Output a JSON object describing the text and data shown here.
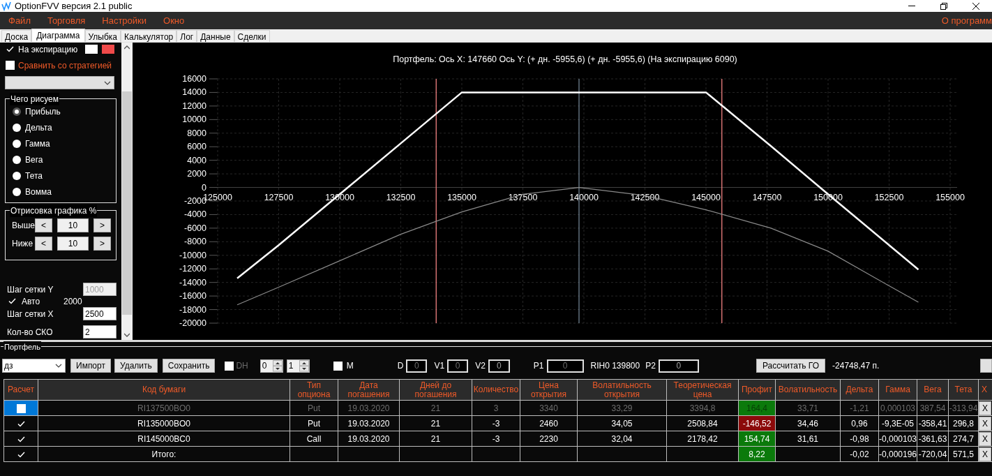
{
  "window": {
    "title": "OptionFVV версия 2.1 public"
  },
  "menu": [
    {
      "label": "Файл"
    },
    {
      "label": "Торговля"
    },
    {
      "label": "Настройки"
    },
    {
      "label": "Окно"
    }
  ],
  "menu_right": {
    "label": "О программ"
  },
  "tabs": [
    {
      "label": "Доска",
      "selected": false
    },
    {
      "label": "Диаграмма",
      "selected": true
    },
    {
      "label": "Улыбка",
      "selected": false
    },
    {
      "label": "Калькулятор",
      "selected": false
    },
    {
      "label": "Лог",
      "selected": false
    },
    {
      "label": "Данные",
      "selected": false
    },
    {
      "label": "Сделки",
      "selected": false
    }
  ],
  "left_panel": {
    "expiration": {
      "label": "На экспирацию",
      "checked": true,
      "swatches": [
        {
          "color": "#ffffff"
        },
        {
          "color": "#f04a4a"
        }
      ]
    },
    "compare": {
      "label": "Сравнить со стратегией",
      "checked": false
    },
    "draw_group": {
      "title": "Чего рисуем",
      "options": [
        {
          "label": "Прибыль",
          "selected": true
        },
        {
          "label": "Дельта",
          "selected": false
        },
        {
          "label": "Гамма",
          "selected": false
        },
        {
          "label": "Вега",
          "selected": false
        },
        {
          "label": "Тета",
          "selected": false
        },
        {
          "label": "Вомма",
          "selected": false
        }
      ]
    },
    "range_group": {
      "title": "Отрисовка графика %",
      "rows": [
        {
          "label": "Выше",
          "dec": "<",
          "value": "10",
          "inc": ">"
        },
        {
          "label": "Ниже",
          "dec": "<",
          "value": "10",
          "inc": ">"
        }
      ]
    },
    "grid_y": {
      "label": "Шаг сетки Y",
      "value": "1000",
      "disabled": true
    },
    "auto": {
      "label": "Авто",
      "checked": true,
      "value": "2000"
    },
    "grid_x": {
      "label": "Шаг сетки X",
      "value": "2500"
    },
    "sko": {
      "label": "Кол-во СКО",
      "value": "2"
    }
  },
  "chart": {
    "chart_data": {
      "type": "line",
      "title": "Портфель: Ось X:  147660 Ось Y:  (+ дн. -5955,6)  (+ дн. -5955,6)  (На экспирацию 6090)",
      "x": [
        125800,
        127500,
        130000,
        132500,
        135000,
        137500,
        139800,
        142500,
        145000,
        147660,
        150000,
        152500,
        153700
      ],
      "xlim": [
        125000,
        155000
      ],
      "ylim": [
        -20000,
        16000
      ],
      "xticks": [
        125000,
        127500,
        130000,
        132500,
        135000,
        137500,
        140000,
        142500,
        145000,
        147500,
        150000,
        152500,
        155000
      ],
      "yticks": [
        -20000,
        -18000,
        -16000,
        -14000,
        -12000,
        -10000,
        -8000,
        -6000,
        -4000,
        -2000,
        0,
        2000,
        4000,
        6000,
        8000,
        10000,
        12000,
        14000,
        16000
      ],
      "series": [
        {
          "color": "#ffffff",
          "values": [
            -13400,
            -8500,
            -1000,
            6500,
            14000,
            14000,
            14000,
            14000,
            14000,
            6100,
            -1000,
            -8500,
            -12100
          ]
        },
        {
          "color": "#8a8a8a",
          "values": [
            -17300,
            -14700,
            -10800,
            -6900,
            -3600,
            -1000,
            0,
            -1200,
            -3300,
            -6000,
            -9400,
            -14500,
            -16900
          ]
        }
      ],
      "grid": true,
      "ref_lines": [
        {
          "axis": "x",
          "value": 133950,
          "color": "#f08080"
        },
        {
          "axis": "x",
          "value": 139800,
          "color": "#6f8090"
        },
        {
          "axis": "x",
          "value": 145650,
          "color": "#f08080"
        }
      ]
    }
  },
  "portfolio": {
    "title": "Портфель",
    "strategy": "дз",
    "buttons": [
      {
        "label": "Импорт"
      },
      {
        "label": "Удалить"
      },
      {
        "label": "Сохранить"
      }
    ],
    "dh": {
      "label": "DH",
      "checked": false,
      "disabled": true
    },
    "spinners": [
      {
        "value": "0"
      },
      {
        "value": "1"
      }
    ],
    "m": {
      "label": "M",
      "checked": false
    },
    "fields": [
      {
        "kind": "field",
        "label": "D",
        "value": "0",
        "disabled": true
      },
      {
        "kind": "field",
        "label": "V1",
        "value": "0",
        "disabled": true
      },
      {
        "kind": "field",
        "label": "V2",
        "value": "0",
        "disabled": false
      },
      {
        "kind": "field",
        "label": "P1",
        "value": "0",
        "disabled": true
      },
      {
        "kind": "text",
        "text": "RIH0 139800"
      },
      {
        "kind": "field",
        "label": "P2",
        "value": "0",
        "disabled": false
      }
    ],
    "calc_button": {
      "label": "Рассчитать ГО"
    },
    "margin": "-24748,47 п.",
    "table": {
      "columns": [
        "Расчет",
        "Код бумаги",
        "Тип опциона",
        "Дата погашения",
        "Дней до погашения",
        "Количество",
        "Цена открытия",
        "Волатильность открытия",
        "Теоретическая цена",
        "Профит",
        "Волатильность",
        "Дельта",
        "Гамма",
        "Вега",
        "Тета",
        "X"
      ],
      "rows": [
        {
          "checked": false,
          "selected": true,
          "color": "#0b7a0b",
          "cells": [
            null,
            "RI137500BO0",
            "Put",
            "19.03.2020",
            "21",
            "3",
            "3340",
            "33,29",
            "3394,8",
            "164,4",
            "33,71",
            "-1,21",
            "0,000103",
            "387,54",
            "-313,94",
            "X"
          ]
        },
        {
          "checked": true,
          "selected": false,
          "color": "#8b0a0a",
          "cells": [
            null,
            "RI135000BO0",
            "Put",
            "19.03.2020",
            "21",
            "-3",
            "2460",
            "34,05",
            "2508,84",
            "-146,52",
            "34,46",
            "0,96",
            "-9,3E-05",
            "-358,41",
            "296,8",
            "X"
          ]
        },
        {
          "checked": true,
          "selected": false,
          "color": "#0b7a0b",
          "cells": [
            null,
            "RI145000BC0",
            "Call",
            "19.03.2020",
            "21",
            "-3",
            "2230",
            "32,04",
            "2178,42",
            "154,74",
            "31,61",
            "-0,98",
            "-0,000103",
            "-361,63",
            "274,7",
            "X"
          ]
        },
        {
          "checked": true,
          "selected": false,
          "color": "#0b7a0b",
          "cells": [
            null,
            "Итого:",
            null,
            null,
            null,
            null,
            null,
            null,
            null,
            "8,22",
            null,
            "-0,02",
            "-0,000196",
            "-720,04",
            "571,5",
            "X"
          ]
        }
      ]
    }
  }
}
